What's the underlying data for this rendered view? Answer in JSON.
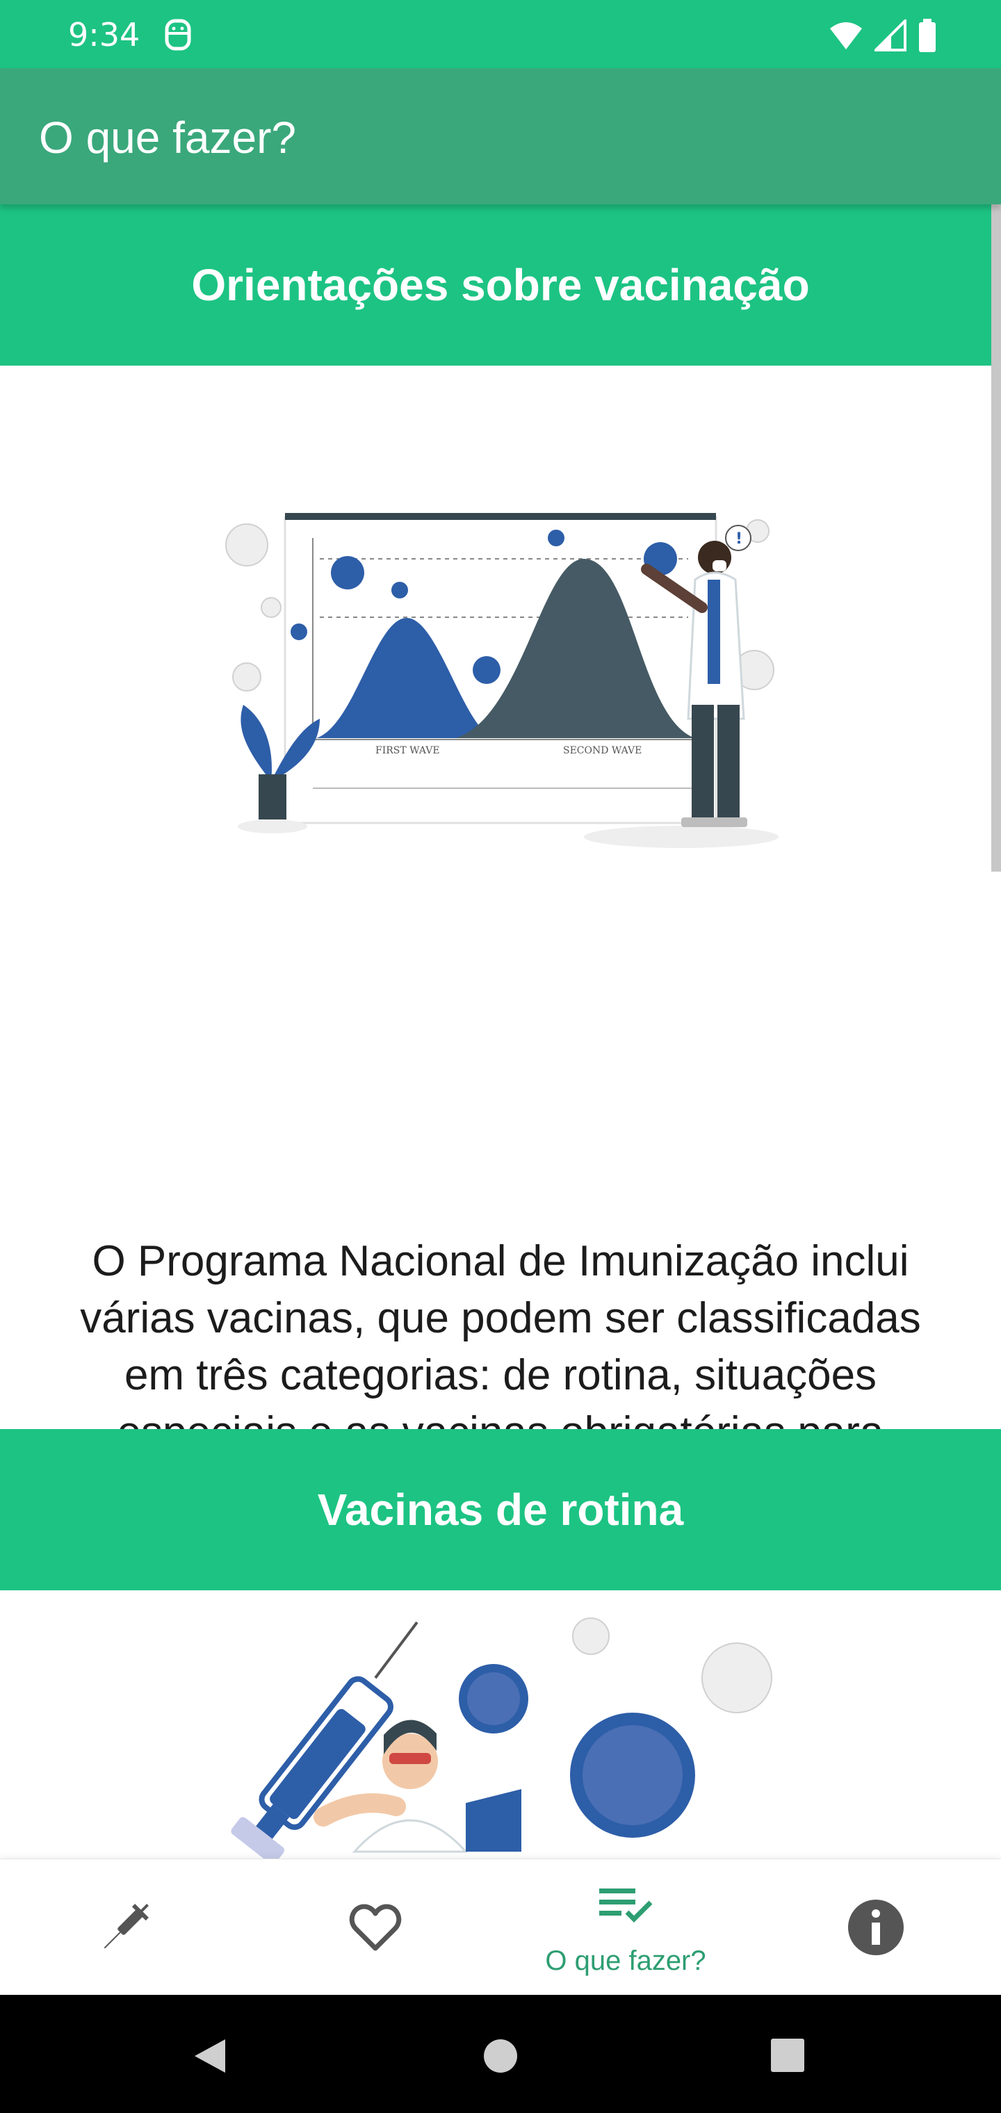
{
  "status_bar": {
    "time": "9:34",
    "icons": [
      "face-icon",
      "wifi-icon",
      "signal-icon",
      "battery-icon"
    ]
  },
  "app_bar": {
    "title": "O que fazer?"
  },
  "sections": [
    {
      "title": "Orientações sobre vacinação"
    },
    {
      "title": "Vacinas de rotina"
    }
  ],
  "illustration_1": {
    "first_wave": "FIRST WAVE",
    "second_wave": "SECOND WAVE"
  },
  "body_text": "O Programa Nacional de Imunização inclui várias vacinas, que podem ser classificadas em três categorias: de rotina, situações especiais e as vacinas obrigatórias para viajantes, exigidas por determinação legal.",
  "bottom_nav": {
    "items": [
      {
        "icon": "syringe-icon",
        "label": ""
      },
      {
        "icon": "heart-icon",
        "label": ""
      },
      {
        "icon": "checklist-icon",
        "label": "O que fazer?",
        "active": true
      },
      {
        "icon": "info-icon",
        "label": ""
      }
    ]
  },
  "system_nav": {
    "buttons": [
      "back-icon",
      "home-icon",
      "recents-icon"
    ]
  },
  "colors": {
    "primary": "#1dc383",
    "app_bar": "#3aa87b",
    "active_nav": "#2e9e72",
    "text": "#1c1c1c"
  }
}
